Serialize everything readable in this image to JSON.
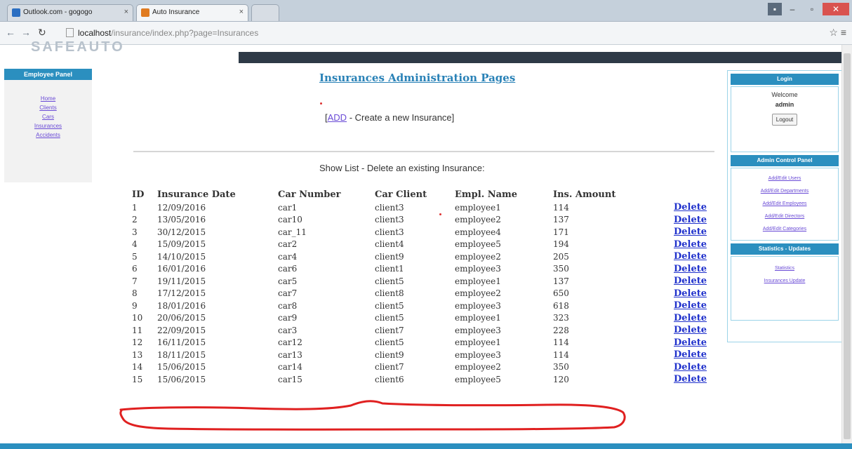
{
  "browser": {
    "tabs": [
      {
        "title": "Outlook.com - gogogo"
      },
      {
        "title": "Auto Insurance"
      }
    ],
    "url_host": "localhost",
    "url_path": "/insurance/index.php?page=Insurances"
  },
  "site": {
    "logo_fragment": "SAFEAUTO"
  },
  "left_panel": {
    "title": "Employee Panel",
    "links": [
      "Home",
      "Clients",
      "Cars",
      "Insurances",
      "Accidents"
    ]
  },
  "main": {
    "title": "Insurances Administration Pages",
    "add_open": "[",
    "add_link": "ADD",
    "add_text": " - Create a new Insurance]",
    "show_list": "Show List - Delete an existing Insurance:",
    "table": {
      "headers": [
        "ID",
        "Insurance Date",
        "Car Number",
        "Car Client",
        "Empl. Name",
        "Ins. Amount"
      ],
      "delete_label": "Delete",
      "rows": [
        [
          "1",
          "12/09/2016",
          "car1",
          "client3",
          "employee1",
          "114"
        ],
        [
          "2",
          "13/05/2016",
          "car10",
          "client3",
          "employee2",
          "137"
        ],
        [
          "3",
          "30/12/2015",
          "car_11",
          "client3",
          "employee4",
          "171"
        ],
        [
          "4",
          "15/09/2015",
          "car2",
          "client4",
          "employee5",
          "194"
        ],
        [
          "5",
          "14/10/2015",
          "car4",
          "client9",
          "employee2",
          "205"
        ],
        [
          "6",
          "16/01/2016",
          "car6",
          "client1",
          "employee3",
          "350"
        ],
        [
          "7",
          "19/11/2015",
          "car5",
          "client5",
          "employee1",
          "137"
        ],
        [
          "8",
          "17/12/2015",
          "car7",
          "client8",
          "employee2",
          "650"
        ],
        [
          "9",
          "18/01/2016",
          "car8",
          "client5",
          "employee3",
          "618"
        ],
        [
          "10",
          "20/06/2015",
          "car9",
          "client5",
          "employee1",
          "323"
        ],
        [
          "11",
          "22/09/2015",
          "car3",
          "client7",
          "employee3",
          "228"
        ],
        [
          "12",
          "16/11/2015",
          "car12",
          "client5",
          "employee1",
          "114"
        ],
        [
          "13",
          "18/11/2015",
          "car13",
          "client9",
          "employee3",
          "114"
        ],
        [
          "14",
          "15/06/2015",
          "car14",
          "client7",
          "employee2",
          "350"
        ],
        [
          "15",
          "15/06/2015",
          "car15",
          "client6",
          "employee5",
          "120"
        ]
      ]
    }
  },
  "right_panel": {
    "login_title": "Login",
    "welcome": "Welcome",
    "user": "admin",
    "logout": "Logout",
    "admin_title": "Admin Control Panel",
    "admin_links": [
      "Add/Edit Users",
      "Add/Edit Departments",
      "Add/Edit Employees",
      "Add/Edit Directors",
      "Add/Edit Categories"
    ],
    "stats_title": "Statistics - Updates",
    "stats_links": [
      "Statistics",
      "Insurances Update"
    ]
  },
  "colors": {
    "accent": "#2b8fbf",
    "link": "#6a4bd6",
    "delete_link": "#2233cc",
    "annotation": "#e02020"
  }
}
